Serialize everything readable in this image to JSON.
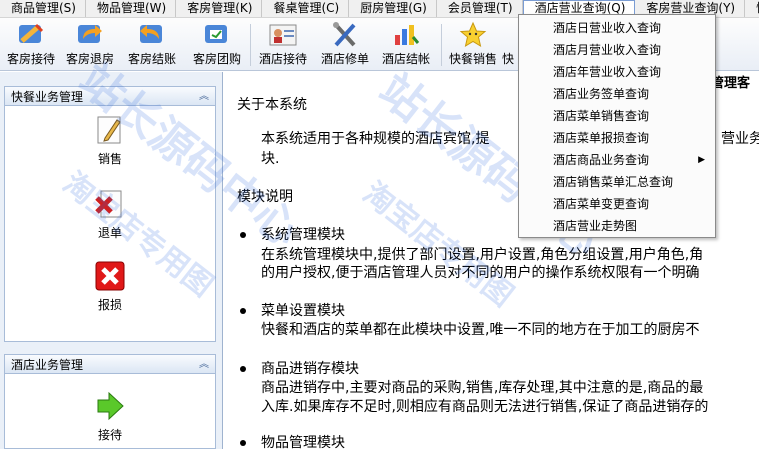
{
  "menu": [
    "商品管理(S)",
    "物品管理(W)",
    "客房管理(K)",
    "餐桌管理(C)",
    "厨房管理(G)",
    "会员管理(T)",
    "酒店营业查询(Q)",
    "客房营业查询(Y)",
    "快餐"
  ],
  "toolbar": [
    {
      "label": "客房接待",
      "icon": "room-reception-icon"
    },
    {
      "label": "客房退房",
      "icon": "room-checkout-icon"
    },
    {
      "label": "客房结账",
      "icon": "room-bill-icon"
    },
    {
      "label": "客房团购",
      "icon": "room-group-icon"
    },
    {
      "label": "酒店接待",
      "icon": "hotel-reception-icon"
    },
    {
      "label": "酒店修单",
      "icon": "hotel-edit-icon"
    },
    {
      "label": "酒店结帐",
      "icon": "hotel-bill-icon"
    },
    {
      "label": "快餐销售",
      "icon": "fastfood-sale-icon"
    },
    {
      "label": "快",
      "icon": ""
    }
  ],
  "left_panel": {
    "group1": {
      "title": "快餐业务管理",
      "items": [
        "销售",
        "退单",
        "报损"
      ]
    },
    "group2": {
      "title": "酒店业务管理",
      "items": [
        "接待"
      ]
    }
  },
  "dropdown": [
    "酒店日营业收入查询",
    "酒店月营业收入查询",
    "酒店年营业收入查询",
    "酒店业务签单查询",
    "酒店菜单销售查询",
    "酒店菜单报损查询",
    "酒店商品业务查询",
    "酒店销售菜单汇总查询",
    "酒店菜单变更查询",
    "酒店营业走势图"
  ],
  "content": {
    "title": "管理客",
    "about_heading": "关于本系统",
    "about_text1": "本系统适用于各种规模的酒店宾馆,提",
    "about_text1b": "营业务档",
    "about_text2": "块.",
    "modules_heading": "模块说明",
    "m1_title": "系统管理模块",
    "m1_l1": "在系统管理模块中,提供了部门设置,用户设置,角色分组设置,用户角色,角",
    "m1_l2": "的用户授权,便于酒店管理人员对不同的用户的操作系统权限有一个明确",
    "m2_title": "菜单设置模块",
    "m2_l1": "快餐和酒店的菜单都在此模块中设置,唯一不同的地方在于加工的厨房不",
    "m3_title": "商品进销存模块",
    "m3_l1": "商品进销存中,主要对商品的采购,销售,库存处理,其中注意的是,商品的最",
    "m3_l2": "入库.如果库存不足时,则相应有商品则无法进行销售,保证了商品进销存的",
    "m4_title": "物品管理模块"
  },
  "watermark": {
    "line1": "站长源码中心",
    "line2": "淘宝店专用图"
  },
  "colors": {
    "accent": "#7a9cd3",
    "panel_bg": "#eaf0f8",
    "watermark": "#2864dc"
  }
}
